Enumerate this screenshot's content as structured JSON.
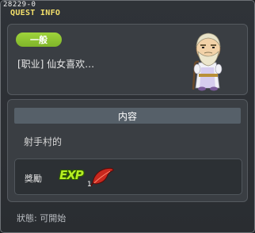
{
  "window": {
    "quest_id": "28229-0",
    "title": "QUEST INFO"
  },
  "quest": {
    "category": "一般",
    "name": "[职业] 仙女喜欢…"
  },
  "content": {
    "header": "内容",
    "description": "射手村的"
  },
  "reward": {
    "label": "獎勵",
    "exp_label": "EXP",
    "item_icon": "red-feather-icon",
    "item_count": "1"
  },
  "status": {
    "text": "狀態:  可開始"
  },
  "colors": {
    "title": "#f4e06b",
    "badge": "#8fc533",
    "exp": "#b6ee22"
  }
}
